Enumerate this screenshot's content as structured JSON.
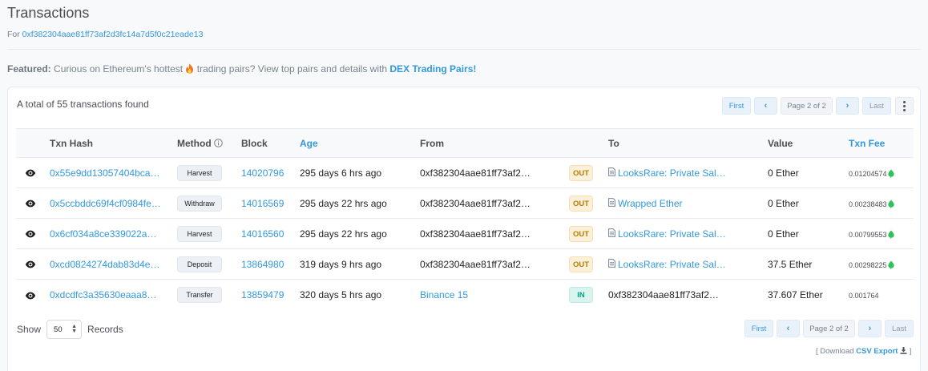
{
  "header": {
    "title": "Transactions",
    "for_label": "For",
    "address": "0xf382304aae81ff73af2d3fc14a7d5f0c21eade13"
  },
  "featured": {
    "label": "Featured:",
    "text_before": "Curious on Ethereum's hottest",
    "text_after": "trading pairs? View top pairs and details with",
    "link": "DEX Trading Pairs!"
  },
  "summary": "A total of 55 transactions found",
  "pagination": {
    "first": "First",
    "prev": "‹",
    "page_info": "Page 2 of 2",
    "next": "›",
    "last": "Last"
  },
  "columns": {
    "hash": "Txn Hash",
    "method": "Method",
    "block": "Block",
    "age": "Age",
    "from": "From",
    "to": "To",
    "value": "Value",
    "fee": "Txn Fee"
  },
  "rows": [
    {
      "hash": "0x55e9dd13057404bca…",
      "method": "Harvest",
      "block": "14020796",
      "age": "295 days 6 hrs ago",
      "from": "0xf382304aae81ff73af2…",
      "from_link": false,
      "dir": "OUT",
      "to": "LooksRare: Private Sal…",
      "to_contract": true,
      "to_link": true,
      "value": "0 Ether",
      "fee": "0.01204574",
      "gas_icon": true
    },
    {
      "hash": "0x5ccbddc69f4cf0984fe…",
      "method": "Withdraw",
      "block": "14016569",
      "age": "295 days 22 hrs ago",
      "from": "0xf382304aae81ff73af2…",
      "from_link": false,
      "dir": "OUT",
      "to": "Wrapped Ether",
      "to_contract": true,
      "to_link": true,
      "value": "0 Ether",
      "fee": "0.00238483",
      "gas_icon": true
    },
    {
      "hash": "0x6cf034a8ce339022a…",
      "method": "Harvest",
      "block": "14016560",
      "age": "295 days 22 hrs ago",
      "from": "0xf382304aae81ff73af2…",
      "from_link": false,
      "dir": "OUT",
      "to": "LooksRare: Private Sal…",
      "to_contract": true,
      "to_link": true,
      "value": "0 Ether",
      "fee": "0.00799553",
      "gas_icon": true
    },
    {
      "hash": "0xcd0824274dab83d4e…",
      "method": "Deposit",
      "block": "13864980",
      "age": "319 days 9 hrs ago",
      "from": "0xf382304aae81ff73af2…",
      "from_link": false,
      "dir": "OUT",
      "to": "LooksRare: Private Sal…",
      "to_contract": true,
      "to_link": true,
      "value": "37.5 Ether",
      "fee": "0.00298225",
      "gas_icon": true
    },
    {
      "hash": "0xdcdfc3a35630eaaa8…",
      "method": "Transfer",
      "block": "13859479",
      "age": "320 days 5 hrs ago",
      "from": "Binance 15",
      "from_link": true,
      "dir": "IN",
      "to": "0xf382304aae81ff73af2…",
      "to_contract": false,
      "to_link": false,
      "value": "37.607 Ether",
      "fee": "0.001764",
      "gas_icon": false
    }
  ],
  "footer": {
    "show_label": "Show",
    "page_size": "50",
    "records_label": "Records",
    "download_prefix": "[ Download",
    "csv_link": "CSV Export",
    "download_suffix": "]"
  },
  "colors": {
    "link": "#3498db",
    "out_badge_bg": "#fcf0db",
    "in_badge_bg": "#daf4f0"
  }
}
